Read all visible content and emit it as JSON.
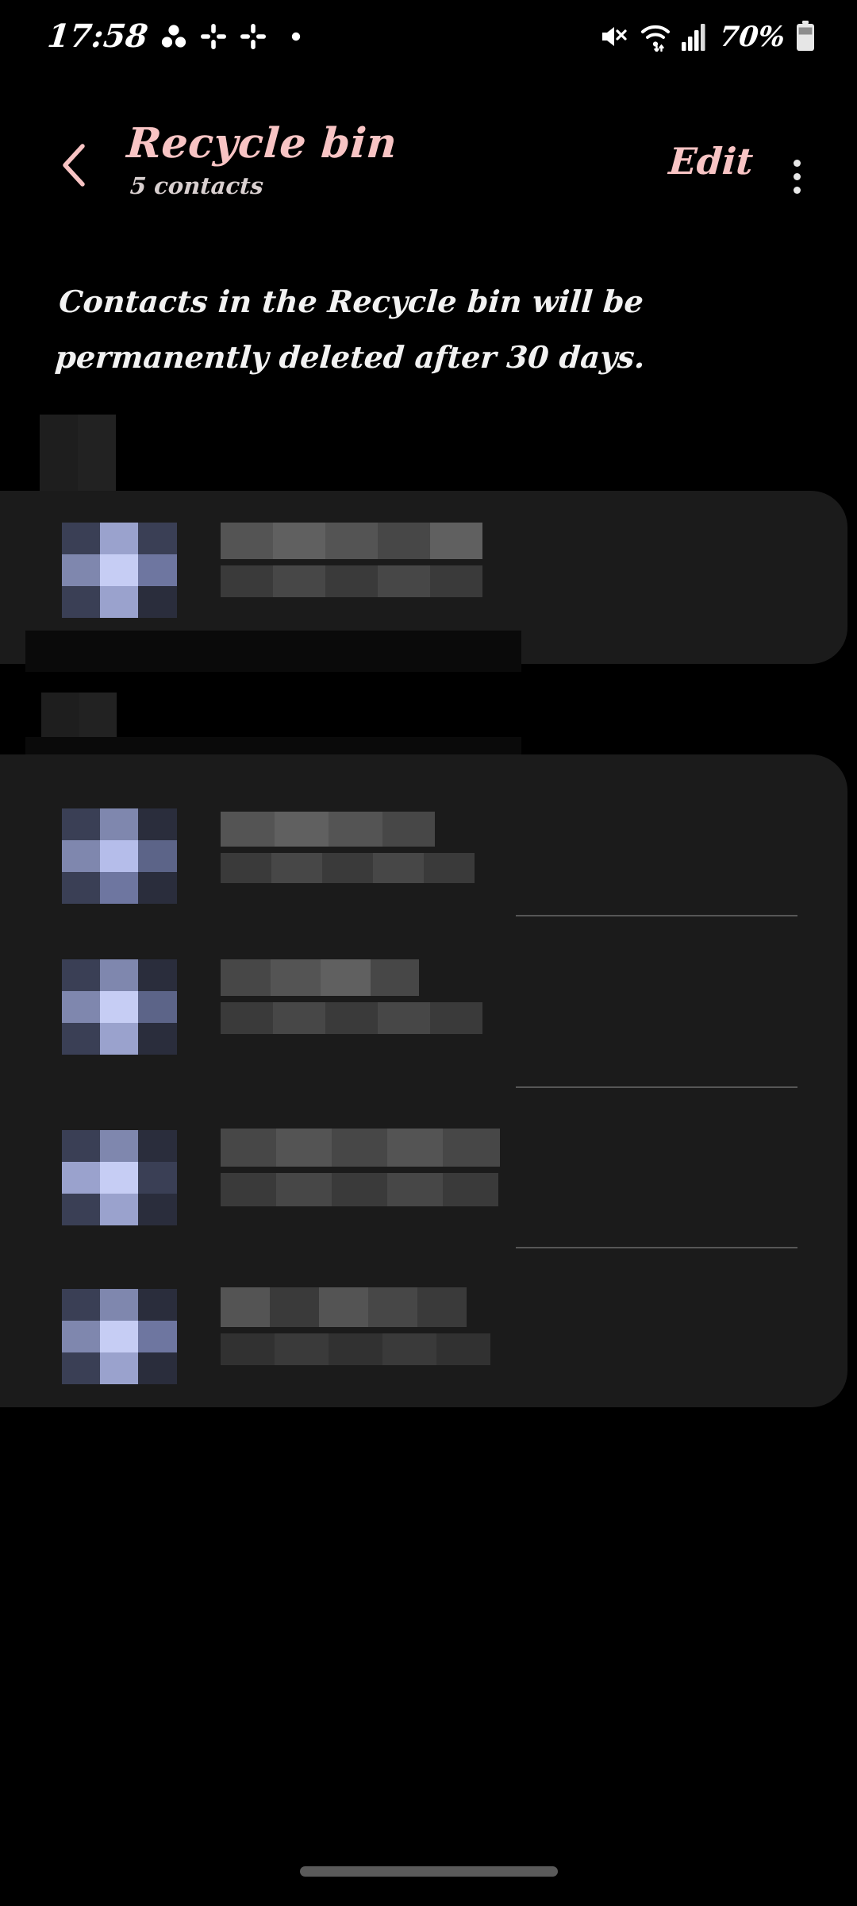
{
  "status_bar": {
    "time": "17:58",
    "battery_percent": "70%",
    "left_icons": [
      "app-dots-icon",
      "slack-icon",
      "slack-icon",
      "small-dot-icon"
    ],
    "right_icons": [
      "mute-icon",
      "wifi-icon",
      "signal-bars-icon",
      "battery-icon"
    ]
  },
  "header": {
    "back_icon": "chevron-left-icon",
    "title": "Recycle bin",
    "subtitle": "5 contacts",
    "edit_label": "Edit",
    "more_icon": "overflow-menu-icon",
    "accent_color": "#F8C4C4"
  },
  "description": {
    "text": "Contacts in the Recycle bin will be permanently deleted after 30 days."
  },
  "contact_list": {
    "redacted": true,
    "redaction_style": "mosaic-pixelation",
    "groups": [
      {
        "id": "group-1",
        "items": [
          {
            "id": "contact-1",
            "avatar": "redacted-avatar",
            "name": "redacted-name",
            "detail": "redacted-detail"
          }
        ]
      },
      {
        "id": "group-2",
        "items": [
          {
            "id": "contact-2",
            "avatar": "redacted-avatar",
            "name": "redacted-name",
            "detail": "redacted-detail"
          },
          {
            "id": "contact-3",
            "avatar": "redacted-avatar",
            "name": "redacted-name",
            "detail": "redacted-detail"
          },
          {
            "id": "contact-4",
            "avatar": "redacted-avatar",
            "name": "redacted-name",
            "detail": "redacted-detail"
          },
          {
            "id": "contact-5",
            "avatar": "redacted-avatar",
            "name": "redacted-name",
            "detail": "redacted-detail"
          }
        ]
      }
    ]
  },
  "nav_bar": {
    "home_indicator": "home-gesture-bar"
  },
  "colors": {
    "background": "#000000",
    "card": "#1b1b1b",
    "accent_pink": "#F8C4C4",
    "text_primary": "#f2f2f2",
    "text_secondary": "#d8cfcf",
    "divider": "#565656"
  }
}
